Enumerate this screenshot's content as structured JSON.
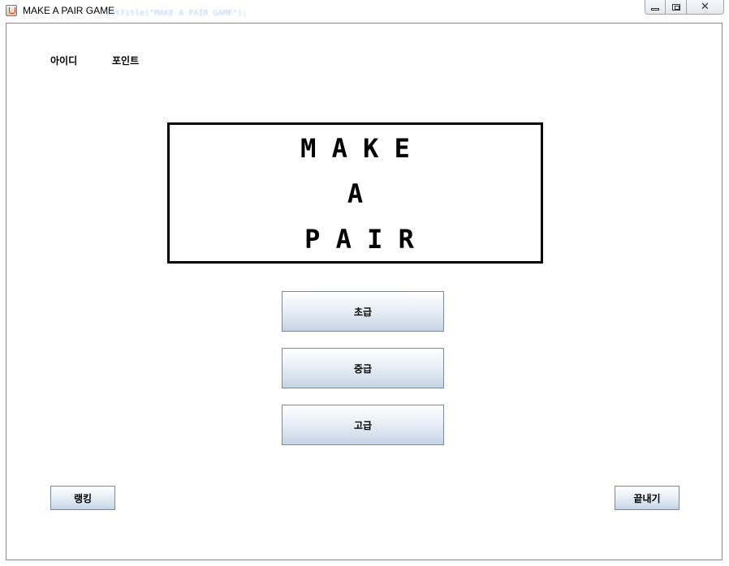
{
  "window": {
    "title": "MAKE A PAIR GAME",
    "background_code_text": "setTitle(\"MAKE A PAIR GAME\");"
  },
  "header": {
    "id_label": "아이디",
    "point_label": "포인트"
  },
  "logo": {
    "line1": "M A K E",
    "line2": "A",
    "line3": "P A I R"
  },
  "levels": {
    "beginner": "초급",
    "intermediate": "중급",
    "advanced": "고급"
  },
  "footer": {
    "ranking": "랭킹",
    "quit": "끝내기"
  },
  "colors": {
    "button_top": "#ffffff",
    "button_bottom": "#c6d3e2",
    "button_border": "#7a8a9e",
    "logo_border": "#000000"
  },
  "icons": {
    "app": "java-cup-icon",
    "minimize": "minimize-icon",
    "maximize": "restore-icon",
    "close": "close-icon"
  }
}
